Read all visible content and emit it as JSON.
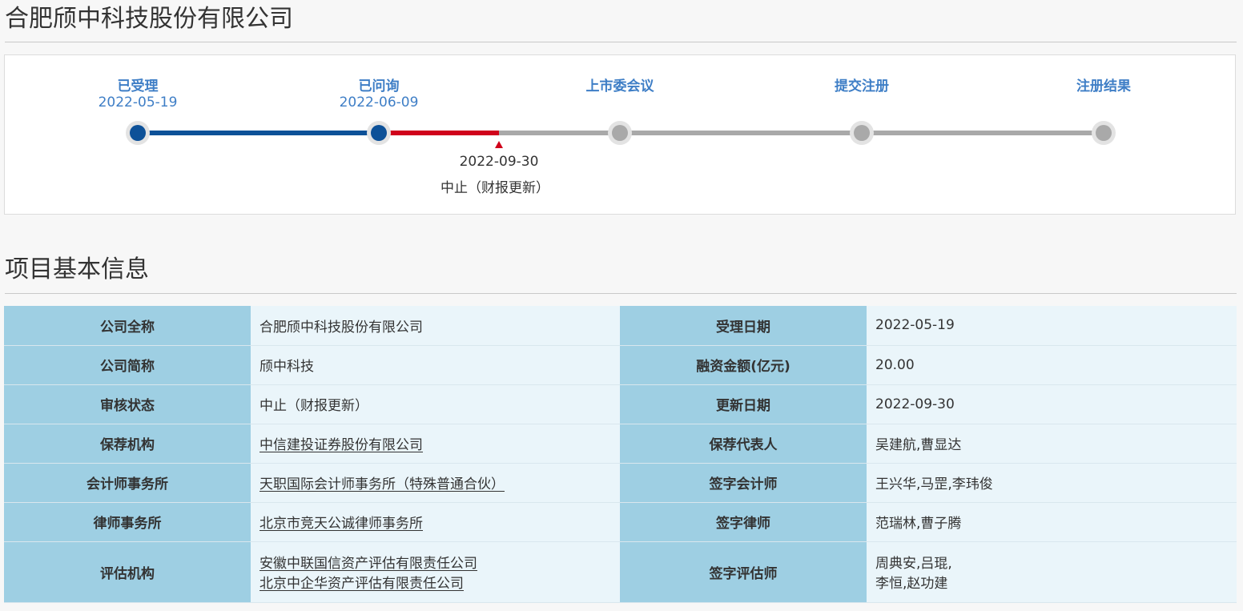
{
  "company_title": "合肥颀中科技股份有限公司",
  "progress": {
    "steps": [
      {
        "name": "已受理",
        "date": "2022-05-19",
        "status": "done"
      },
      {
        "name": "已问询",
        "date": "2022-06-09",
        "status": "done"
      },
      {
        "name": "上市委会议",
        "date": "",
        "status": "pending"
      },
      {
        "name": "提交注册",
        "date": "",
        "status": "pending"
      },
      {
        "name": "注册结果",
        "date": "",
        "status": "pending"
      }
    ],
    "current": {
      "date": "2022-09-30",
      "status": "中止（财报更新）"
    }
  },
  "section_title": "项目基本信息",
  "info_rows": [
    {
      "label1": "公司全称",
      "value1": [
        "合肥颀中科技股份有限公司"
      ],
      "link1": false,
      "label2": "受理日期",
      "value2": [
        "2022-05-19"
      ]
    },
    {
      "label1": "公司简称",
      "value1": [
        "颀中科技"
      ],
      "link1": false,
      "label2": "融资金额(亿元)",
      "value2": [
        "20.00"
      ]
    },
    {
      "label1": "审核状态",
      "value1": [
        "中止（财报更新）"
      ],
      "link1": false,
      "label2": "更新日期",
      "value2": [
        "2022-09-30"
      ]
    },
    {
      "label1": "保荐机构",
      "value1": [
        "中信建投证券股份有限公司"
      ],
      "link1": true,
      "label2": "保荐代表人",
      "value2": [
        "吴建航,曹显达"
      ]
    },
    {
      "label1": "会计师事务所",
      "value1": [
        "天职国际会计师事务所（特殊普通合伙）"
      ],
      "link1": true,
      "label2": "签字会计师",
      "value2": [
        "王兴华,马罡,李玮俊"
      ]
    },
    {
      "label1": "律师事务所",
      "value1": [
        "北京市竞天公诚律师事务所"
      ],
      "link1": true,
      "label2": "签字律师",
      "value2": [
        "范瑞林,曹子腾"
      ]
    },
    {
      "label1": "评估机构",
      "value1": [
        "安徽中联国信资产评估有限责任公司",
        "北京中企华资产评估有限责任公司"
      ],
      "link1": true,
      "label2": "签字评估师",
      "value2": [
        "周典安,吕琨,",
        "李恒,赵功建"
      ]
    }
  ],
  "colors": {
    "done": "#0d5198",
    "current_segment": "#d0021b",
    "pending": "#a9a9a9",
    "label_bg": "#9ecfe3",
    "value_bg": "#eaf5fa",
    "step_text": "#3e7ec6"
  }
}
